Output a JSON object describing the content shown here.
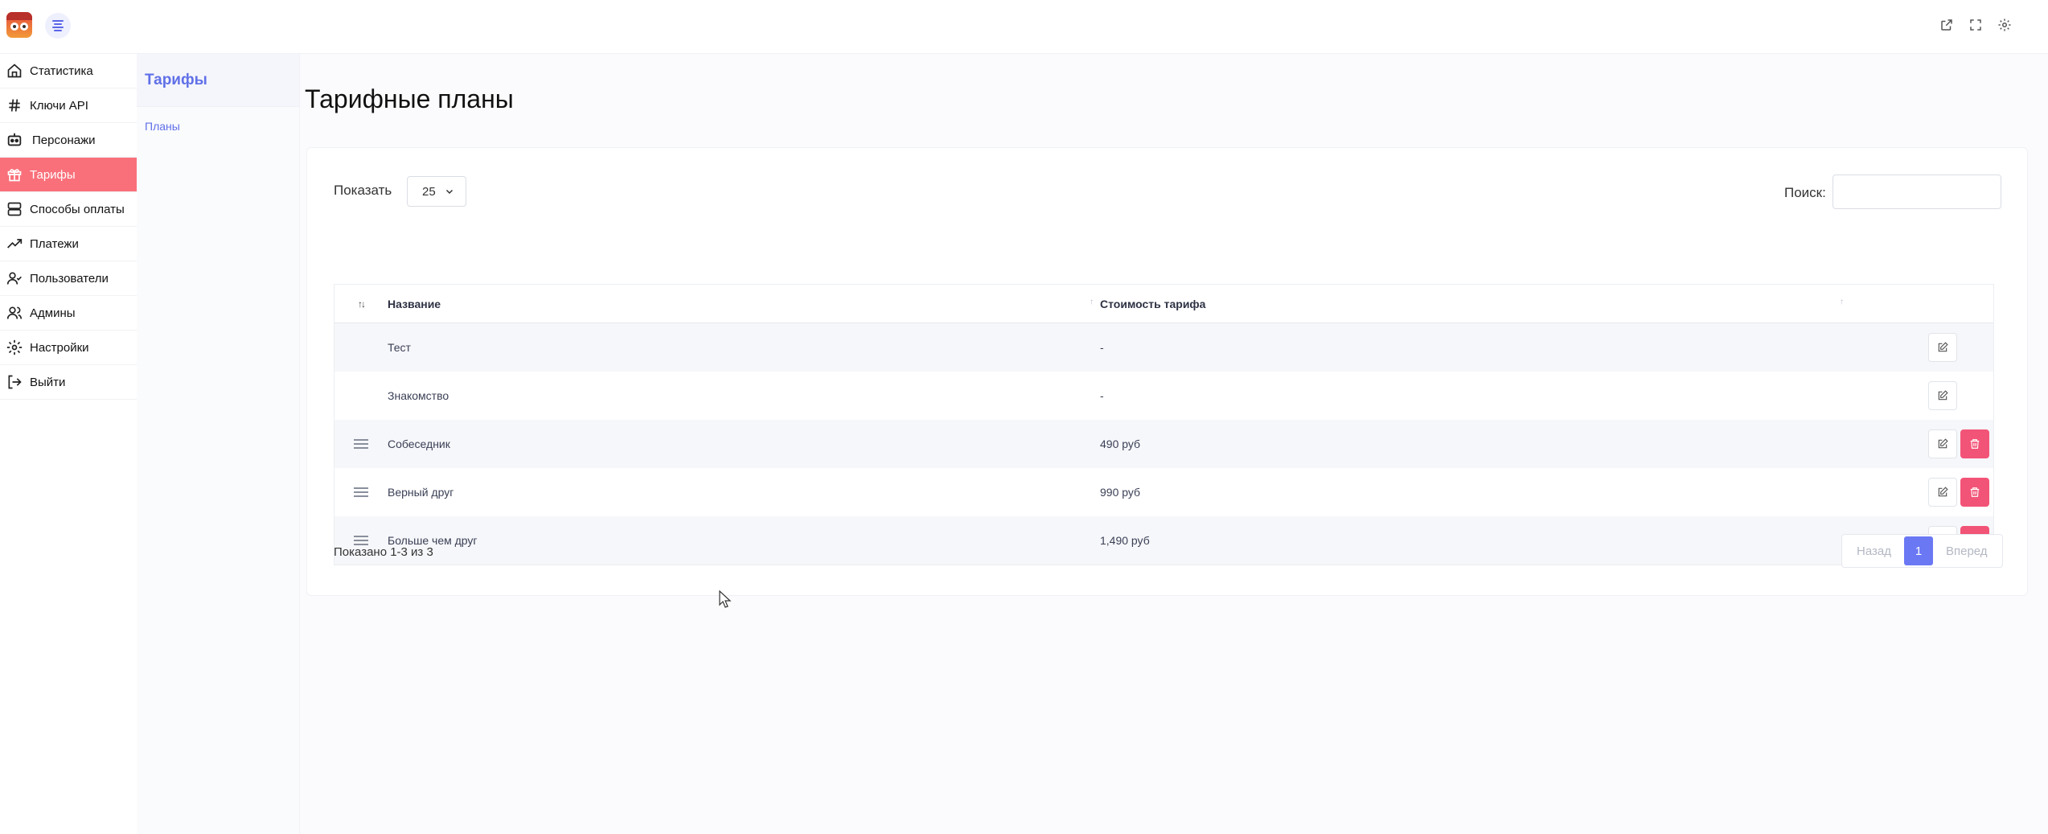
{
  "topbar": {
    "icons": [
      "robot-logo-icon",
      "menu-toggle-icon",
      "external-link-icon",
      "fullscreen-icon",
      "settings-gear-icon"
    ]
  },
  "sidebar": {
    "items": [
      {
        "label": "Статистика",
        "icon": "home-icon",
        "active": false
      },
      {
        "label": "Ключи API",
        "icon": "hash-icon",
        "active": false
      },
      {
        "label": "Персонажи",
        "icon": "robot-icon",
        "active": false
      },
      {
        "label": "Тарифы",
        "icon": "gift-icon",
        "active": true
      },
      {
        "label": "Способы оплаты",
        "icon": "server-icon",
        "active": false
      },
      {
        "label": "Платежи",
        "icon": "trending-up-icon",
        "active": false
      },
      {
        "label": "Пользователи",
        "icon": "user-check-icon",
        "active": false
      },
      {
        "label": "Админы",
        "icon": "users-icon",
        "active": false
      },
      {
        "label": "Настройки",
        "icon": "settings-icon",
        "active": false
      },
      {
        "label": "Выйти",
        "icon": "logout-icon",
        "active": false
      }
    ],
    "active_color": "#f9707a"
  },
  "subpanel": {
    "title": "Тарифы",
    "links": [
      "Планы"
    ],
    "accent_color": "#6070e8"
  },
  "main": {
    "page_title": "Тарифные планы",
    "show_label": "Показать",
    "show_value": "25",
    "search_label": "Поиск:",
    "search_value": "",
    "table": {
      "columns": [
        "Название",
        "Стоимость тарифа"
      ],
      "sort_indicator": "↑↓",
      "rows": [
        {
          "name": "Тест",
          "cost": "-",
          "draggable": false,
          "deletable": false
        },
        {
          "name": "Знакомство",
          "cost": "-",
          "draggable": false,
          "deletable": false
        },
        {
          "name": "Собеседник",
          "cost": "490 руб",
          "draggable": true,
          "deletable": true
        },
        {
          "name": "Верный друг",
          "cost": "990 руб",
          "draggable": true,
          "deletable": true
        },
        {
          "name": "Больше чем друг",
          "cost": "1,490 руб",
          "draggable": true,
          "deletable": true
        }
      ]
    },
    "info_text": "Показано 1-3 из 3",
    "pagination": {
      "prev": "Назад",
      "current": "1",
      "next": "Вперед",
      "current_color": "#6b78f4"
    },
    "delete_color": "#f25477"
  }
}
